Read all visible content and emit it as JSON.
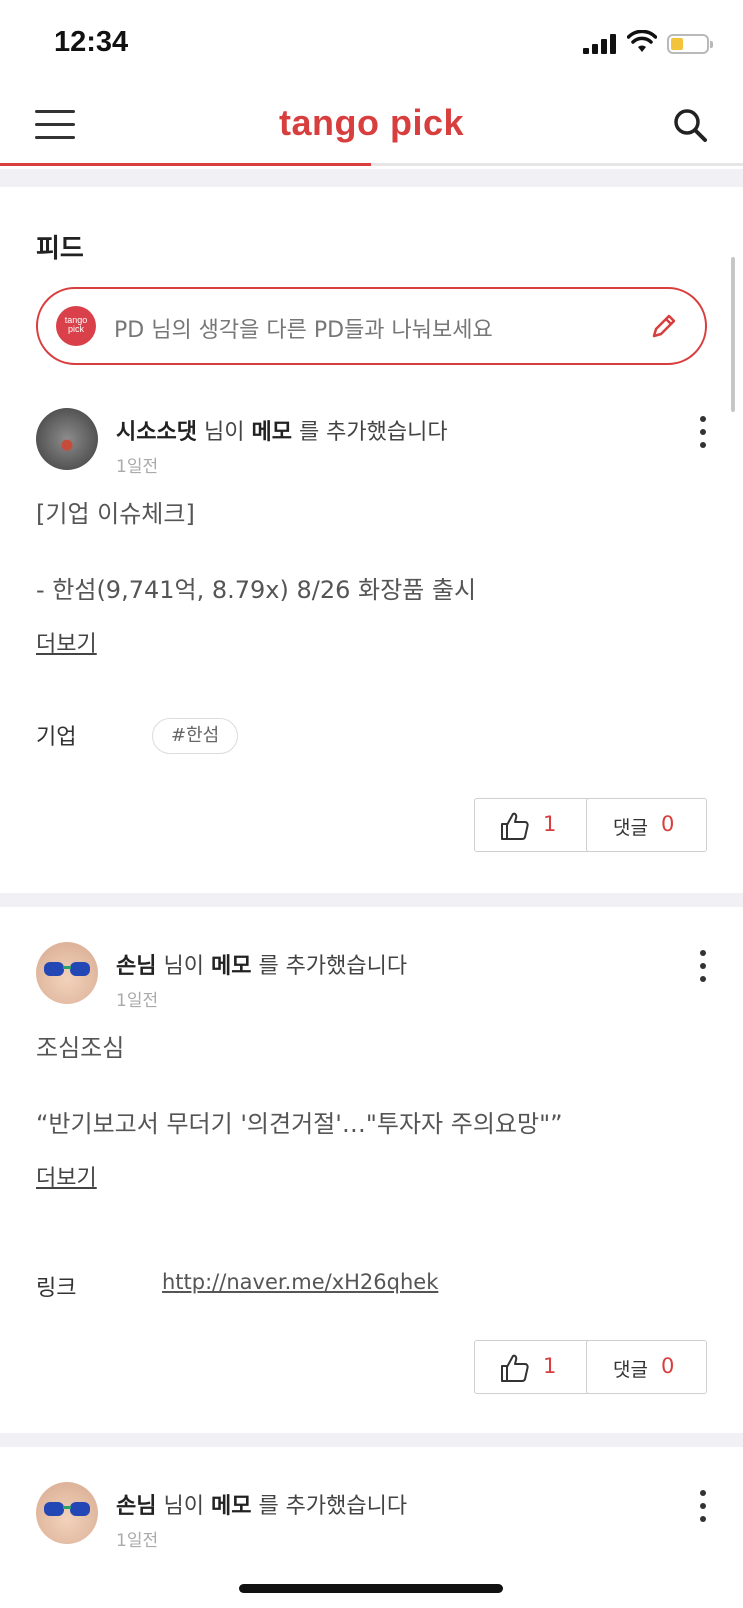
{
  "status_bar": {
    "time": "12:34"
  },
  "nav": {
    "logo": "tango pick"
  },
  "feed": {
    "title": "피드",
    "compose_placeholder": "PD 님의 생각을 다른 PD들과 나눠보세요",
    "compose_avatar_text_1": "tango",
    "compose_avatar_text_2": "pick"
  },
  "posts": [
    {
      "author": "시소소댓",
      "action_prefix": "님이",
      "item": "메모",
      "action_suffix": "를 추가했습니다",
      "time": "1일전",
      "lines": [
        "[기업 이슈체크]",
        "- 한섬(9,741억, 8.79x) 8/26 화장품 출시"
      ],
      "more_label": "더보기",
      "meta_label": "기업",
      "tag": "#한섬",
      "likes": "1",
      "comment_label": "댓글",
      "comments": "0"
    },
    {
      "author": "손님",
      "action_prefix": "님이",
      "item": "메모",
      "action_suffix": "를 추가했습니다",
      "time": "1일전",
      "lines": [
        "조심조심",
        "“반기보고서 무더기 '의견거절'…\"투자자 주의요망\"”"
      ],
      "more_label": "더보기",
      "meta_label": "링크",
      "link": "http://naver.me/xH26qhek",
      "likes": "1",
      "comment_label": "댓글",
      "comments": "0"
    },
    {
      "author": "손님",
      "action_prefix": "님이",
      "item": "메모",
      "action_suffix": "를 추가했습니다",
      "time": "1일전"
    }
  ]
}
